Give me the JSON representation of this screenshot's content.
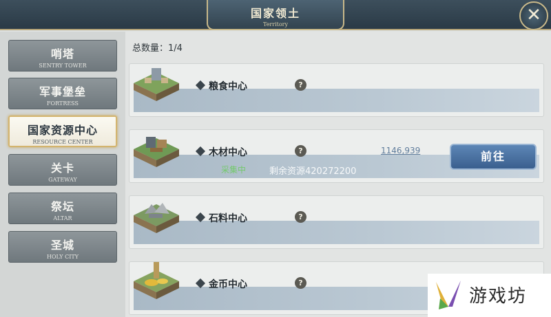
{
  "header": {
    "title": "国家领土",
    "subtitle": "Territory"
  },
  "sidebar": {
    "items": [
      {
        "label": "哨塔",
        "sub": "SENTRY TOWER",
        "active": false
      },
      {
        "label": "军事堡垒",
        "sub": "FORTRESS",
        "active": false
      },
      {
        "label": "国家资源中心",
        "sub": "RESOURCE CENTER",
        "active": true
      },
      {
        "label": "关卡",
        "sub": "GATEWAY",
        "active": false
      },
      {
        "label": "祭坛",
        "sub": "ALTAR",
        "active": false
      },
      {
        "label": "圣城",
        "sub": "HOLY CITY",
        "active": false
      }
    ]
  },
  "main": {
    "count_label": "总数量：1/4",
    "resources": [
      {
        "name": "粮食中心",
        "help": "?"
      },
      {
        "name": "木材中心",
        "help": "?",
        "status": "采集中",
        "remaining": "剩余资源420272200",
        "number": "1146,939",
        "action": "前往"
      },
      {
        "name": "石料中心",
        "help": "?"
      },
      {
        "name": "金币中心",
        "help": "?"
      }
    ]
  },
  "watermark": {
    "text": "游戏坊"
  },
  "icons": {
    "close": "close-icon",
    "help": "question-icon",
    "diamond": "diamond-icon"
  }
}
